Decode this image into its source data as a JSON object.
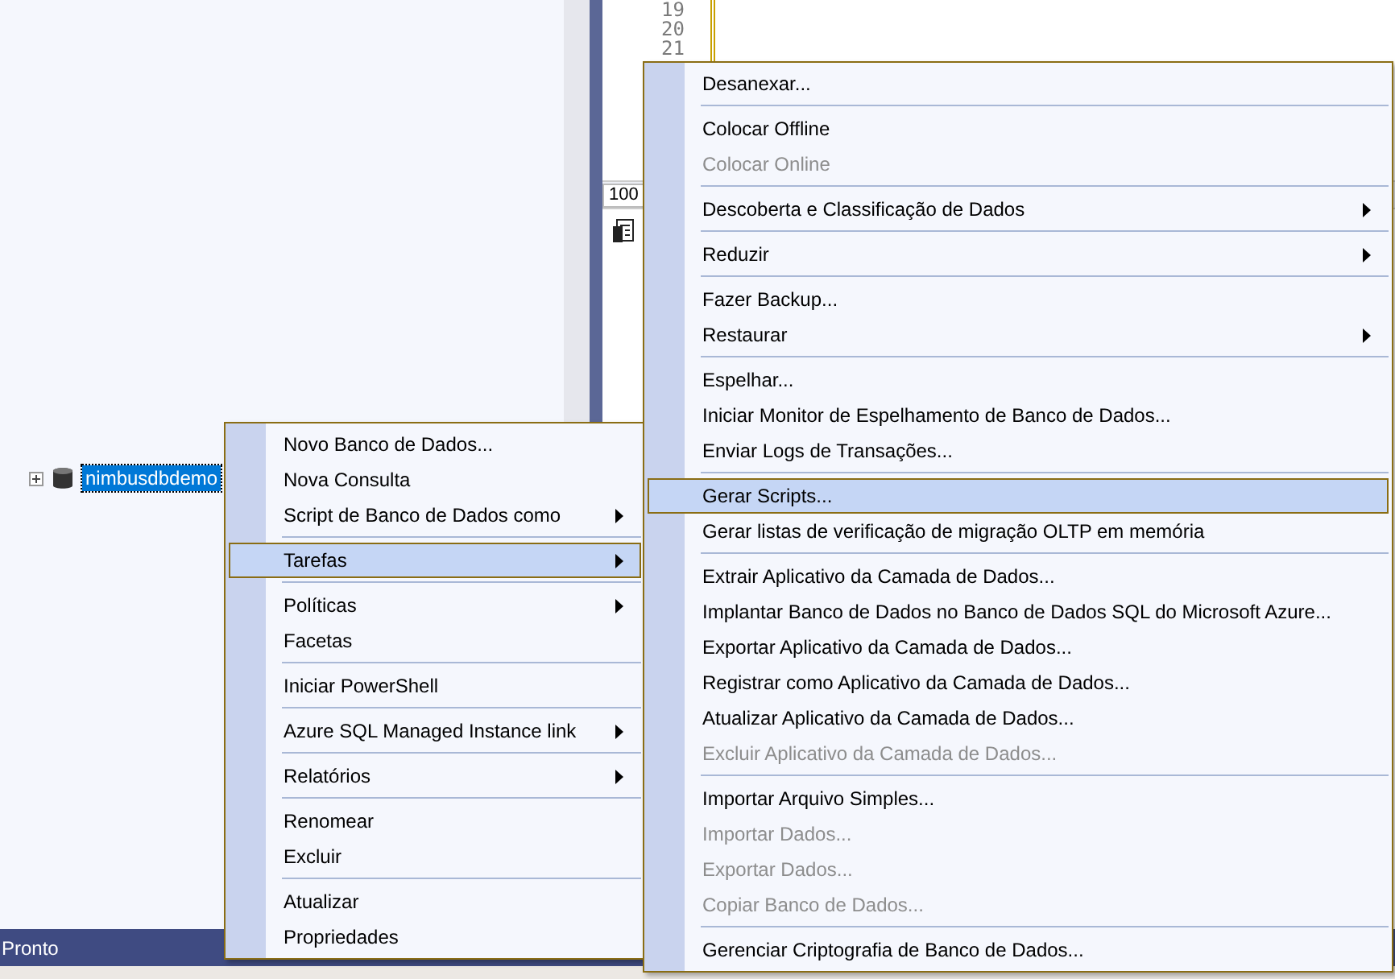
{
  "editor": {
    "line_numbers": [
      "19",
      "20",
      "21"
    ],
    "zoom": "100"
  },
  "object_explorer": {
    "node": {
      "label": "nimbusdbdemo",
      "selected": true,
      "expanded": false
    }
  },
  "context_menu": {
    "items": [
      {
        "kind": "item",
        "label": "Novo Banco de Dados...",
        "submenu": false,
        "selected": false
      },
      {
        "kind": "item",
        "label": "Nova Consulta",
        "submenu": false,
        "selected": false
      },
      {
        "kind": "item",
        "label": "Script de Banco de Dados como",
        "submenu": true,
        "selected": false
      },
      {
        "kind": "separator"
      },
      {
        "kind": "item",
        "label": "Tarefas",
        "submenu": true,
        "selected": true
      },
      {
        "kind": "separator"
      },
      {
        "kind": "item",
        "label": "Políticas",
        "submenu": true,
        "selected": false
      },
      {
        "kind": "item",
        "label": "Facetas",
        "submenu": false,
        "selected": false
      },
      {
        "kind": "separator"
      },
      {
        "kind": "item",
        "label": "Iniciar PowerShell",
        "submenu": false,
        "selected": false
      },
      {
        "kind": "separator"
      },
      {
        "kind": "item",
        "label": "Azure SQL Managed Instance link",
        "submenu": true,
        "selected": false
      },
      {
        "kind": "separator"
      },
      {
        "kind": "item",
        "label": "Relatórios",
        "submenu": true,
        "selected": false
      },
      {
        "kind": "separator"
      },
      {
        "kind": "item",
        "label": "Renomear",
        "submenu": false,
        "selected": false
      },
      {
        "kind": "item",
        "label": "Excluir",
        "submenu": false,
        "selected": false
      },
      {
        "kind": "separator"
      },
      {
        "kind": "item",
        "label": "Atualizar",
        "submenu": false,
        "selected": false
      },
      {
        "kind": "item",
        "label": "Propriedades",
        "submenu": false,
        "selected": false
      }
    ]
  },
  "tasks_submenu": {
    "items": [
      {
        "kind": "item",
        "label": "Desanexar...",
        "submenu": false,
        "selected": false,
        "disabled": false
      },
      {
        "kind": "separator"
      },
      {
        "kind": "item",
        "label": "Colocar Offline",
        "submenu": false,
        "selected": false,
        "disabled": false
      },
      {
        "kind": "item",
        "label": "Colocar Online",
        "submenu": false,
        "selected": false,
        "disabled": true
      },
      {
        "kind": "separator"
      },
      {
        "kind": "item",
        "label": "Descoberta e Classificação de Dados",
        "submenu": true,
        "selected": false,
        "disabled": false
      },
      {
        "kind": "separator"
      },
      {
        "kind": "item",
        "label": "Reduzir",
        "submenu": true,
        "selected": false,
        "disabled": false
      },
      {
        "kind": "separator"
      },
      {
        "kind": "item",
        "label": "Fazer Backup...",
        "submenu": false,
        "selected": false,
        "disabled": false
      },
      {
        "kind": "item",
        "label": "Restaurar",
        "submenu": true,
        "selected": false,
        "disabled": false
      },
      {
        "kind": "separator"
      },
      {
        "kind": "item",
        "label": "Espelhar...",
        "submenu": false,
        "selected": false,
        "disabled": false
      },
      {
        "kind": "item",
        "label": "Iniciar Monitor de Espelhamento de Banco de Dados...",
        "submenu": false,
        "selected": false,
        "disabled": false
      },
      {
        "kind": "item",
        "label": "Enviar Logs de Transações...",
        "submenu": false,
        "selected": false,
        "disabled": false
      },
      {
        "kind": "separator"
      },
      {
        "kind": "item",
        "label": "Gerar Scripts...",
        "submenu": false,
        "selected": true,
        "disabled": false
      },
      {
        "kind": "item",
        "label": "Gerar listas de verificação de migração OLTP em memória",
        "submenu": false,
        "selected": false,
        "disabled": false
      },
      {
        "kind": "separator"
      },
      {
        "kind": "item",
        "label": "Extrair Aplicativo da Camada de Dados...",
        "submenu": false,
        "selected": false,
        "disabled": false
      },
      {
        "kind": "item",
        "label": "Implantar Banco de Dados no Banco de Dados SQL do Microsoft Azure...",
        "submenu": false,
        "selected": false,
        "disabled": false
      },
      {
        "kind": "item",
        "label": "Exportar Aplicativo da Camada de Dados...",
        "submenu": false,
        "selected": false,
        "disabled": false
      },
      {
        "kind": "item",
        "label": "Registrar como Aplicativo da Camada de Dados...",
        "submenu": false,
        "selected": false,
        "disabled": false
      },
      {
        "kind": "item",
        "label": "Atualizar Aplicativo da Camada de Dados...",
        "submenu": false,
        "selected": false,
        "disabled": false
      },
      {
        "kind": "item",
        "label": "Excluir Aplicativo da Camada de Dados...",
        "submenu": false,
        "selected": false,
        "disabled": true
      },
      {
        "kind": "separator"
      },
      {
        "kind": "item",
        "label": "Importar Arquivo Simples...",
        "submenu": false,
        "selected": false,
        "disabled": false
      },
      {
        "kind": "item",
        "label": "Importar Dados...",
        "submenu": false,
        "selected": false,
        "disabled": true
      },
      {
        "kind": "item",
        "label": "Exportar Dados...",
        "submenu": false,
        "selected": false,
        "disabled": true
      },
      {
        "kind": "item",
        "label": "Copiar Banco de Dados...",
        "submenu": false,
        "selected": false,
        "disabled": true
      },
      {
        "kind": "separator"
      },
      {
        "kind": "item",
        "label": "Gerenciar Criptografia de Banco de Dados...",
        "submenu": false,
        "selected": false,
        "disabled": false
      }
    ]
  },
  "status_bar": {
    "text": "Pronto"
  }
}
